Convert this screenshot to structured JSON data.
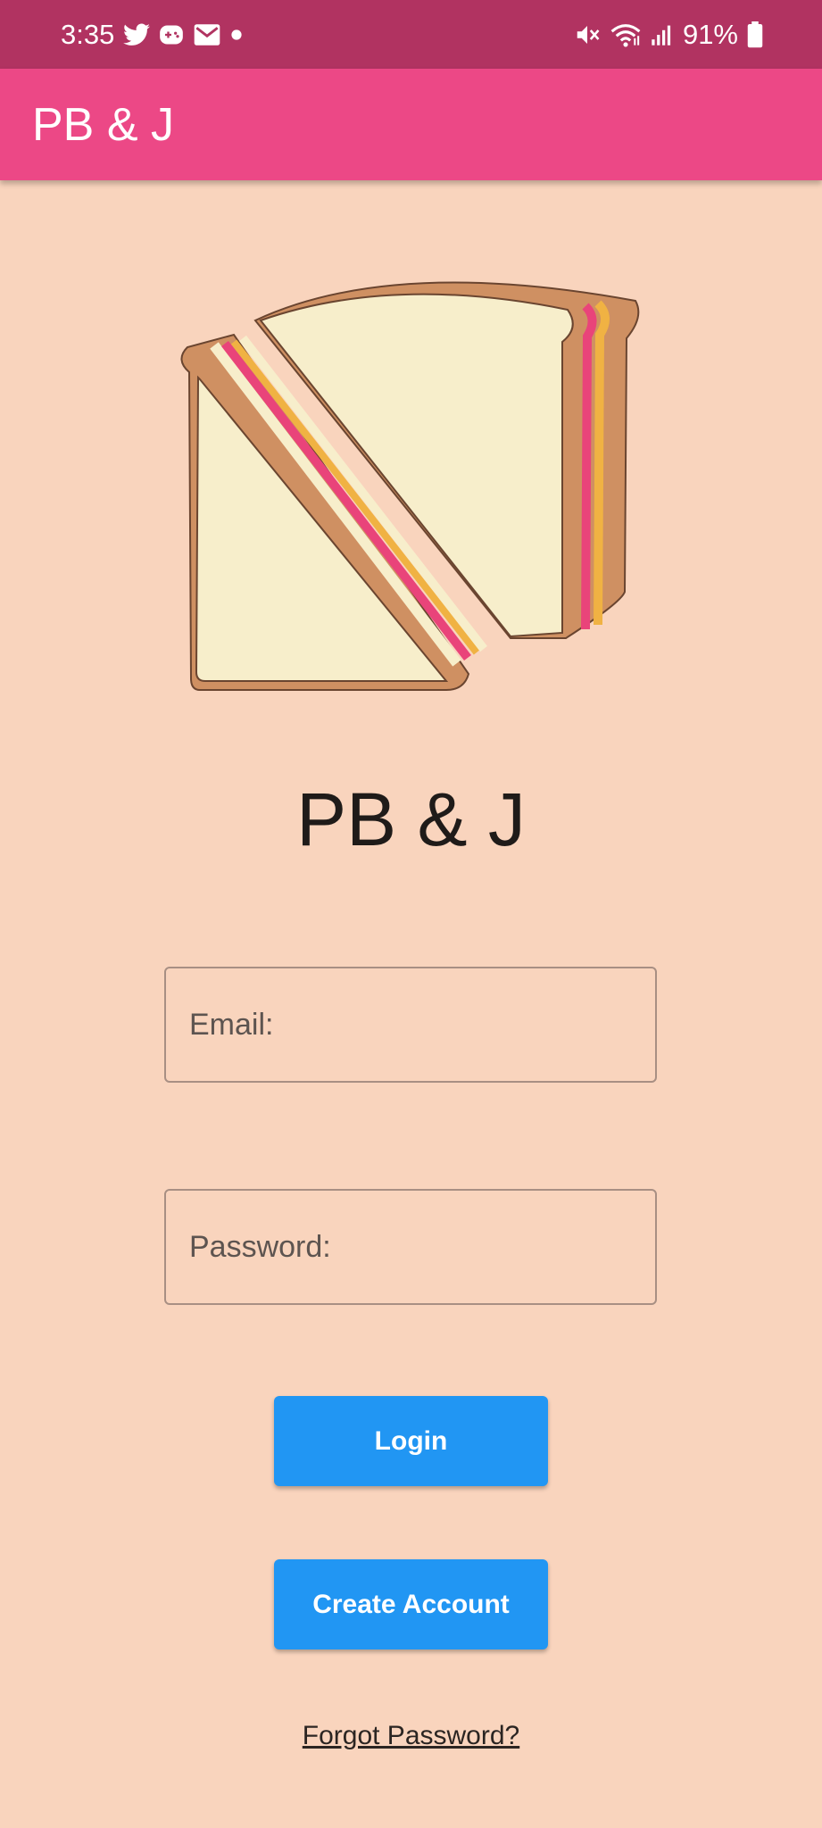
{
  "status_bar": {
    "time": "3:35",
    "battery": "91%",
    "icons": [
      "twitter-icon",
      "game-icon",
      "mail-icon",
      "dot-icon",
      "mute-icon",
      "wifi-icon",
      "signal-icon",
      "battery-icon"
    ]
  },
  "app_bar": {
    "title": "PB & J",
    "color": "#ec4886"
  },
  "brand": {
    "title": "PB & J",
    "logo_icon": "sandwich-icon"
  },
  "login_form": {
    "email_placeholder": "Email:",
    "email_value": "",
    "password_placeholder": "Password:",
    "password_value": "",
    "login_label": "Login",
    "create_account_label": "Create Account",
    "forgot_password_label": "Forgot Password?"
  },
  "colors": {
    "status_bar": "#b13361",
    "background": "#f9d4bd",
    "button": "#2196f3"
  }
}
